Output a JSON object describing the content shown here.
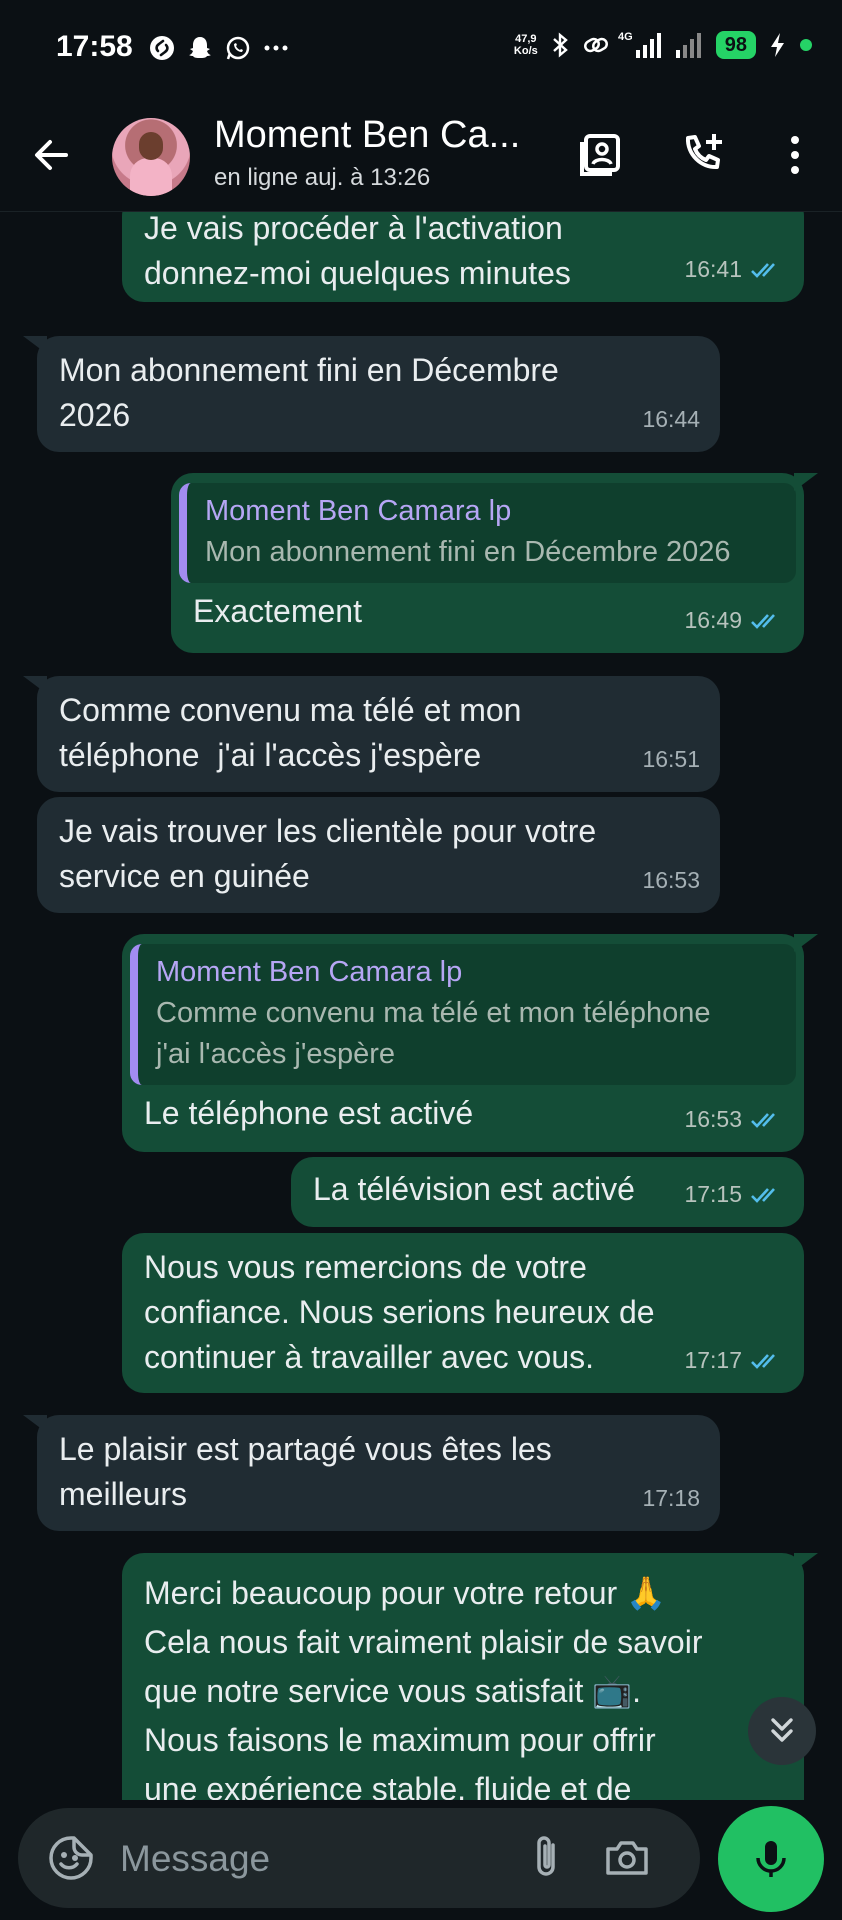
{
  "status_bar": {
    "time": "17:58",
    "net_speed_value": "47,9",
    "net_speed_unit": "Ko/s",
    "network": "4G",
    "battery": "98"
  },
  "header": {
    "contact_name": "Moment Ben Ca...",
    "contact_status": "en ligne auj. à 13:26"
  },
  "messages": [
    {
      "dir": "out",
      "text": "Je vais procéder à l'activation\ndonnez-moi quelques minutes",
      "time": "16:41",
      "read": true
    },
    {
      "dir": "in",
      "text": "Mon abonnement fini en Décembre\n2026",
      "time": "16:44"
    },
    {
      "dir": "out",
      "quote_name": "Moment Ben Camara lp",
      "quote_text": "Mon abonnement fini en Décembre 2026",
      "text": "Exactement",
      "time": "16:49",
      "read": true
    },
    {
      "dir": "in",
      "text": "Comme convenu ma télé et mon\ntéléphone  j'ai l'accès j'espère",
      "time": "16:51"
    },
    {
      "dir": "in",
      "text": "Je vais trouver les clientèle pour votre\nservice en guinée",
      "time": "16:53"
    },
    {
      "dir": "out",
      "quote_name": "Moment Ben Camara lp",
      "quote_text": "Comme convenu ma télé et mon téléphone\nj'ai l'accès j'espère",
      "text": "Le téléphone est activé",
      "time": "16:53",
      "read": true
    },
    {
      "dir": "out",
      "text": "La télévision est activé",
      "time": "17:15",
      "read": true
    },
    {
      "dir": "out",
      "text": "Nous vous remercions de votre\nconfiance. Nous serions heureux de\ncontinuer à travailler avec vous.",
      "time": "17:17",
      "read": true
    },
    {
      "dir": "in",
      "text": "Le plaisir est partagé vous êtes les\nmeilleurs",
      "time": "17:18"
    },
    {
      "dir": "out",
      "text": "Merci beaucoup pour votre retour 🙏\nCela nous fait vraiment plaisir de savoir\nque notre service vous satisfait 📺.\nNous faisons le maximum pour offrir\nune expérience stable, fluide et de"
    }
  ],
  "input": {
    "placeholder": "Message"
  },
  "colors": {
    "background": "#0b1014",
    "incoming_bubble": "#202c33",
    "outgoing_bubble": "#144d37",
    "read_ticks": "#53bdeb",
    "accent_green": "#21c063",
    "quote_bar": "#a38cf1"
  },
  "icons": {
    "back": "arrow-left-icon",
    "contact_card": "contact-card-icon",
    "add_call": "phone-plus-icon",
    "menu": "more-vertical-icon",
    "sticker": "sticker-icon",
    "attach": "paperclip-icon",
    "camera": "camera-icon",
    "mic": "microphone-icon",
    "scroll_down": "double-chevron-down-icon"
  }
}
